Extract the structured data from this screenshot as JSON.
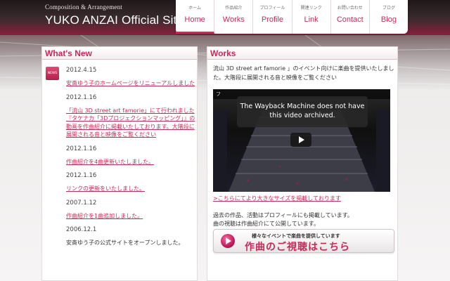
{
  "brand": {
    "subtitle": "Composition & Arrangement",
    "title": "YUKO ANZAI Official Site"
  },
  "nav": [
    {
      "jp": "ホーム",
      "en": "Home"
    },
    {
      "jp": "作品紹介",
      "en": "Works"
    },
    {
      "jp": "プロフィール",
      "en": "Profile"
    },
    {
      "jp": "関連リンク",
      "en": "Link"
    },
    {
      "jp": "お問い合わせ",
      "en": "Contact"
    },
    {
      "jp": "ブログ",
      "en": "Blog"
    }
  ],
  "whats_new": {
    "title": "What's New",
    "badge": "NEWS",
    "items": [
      {
        "date": "2012.4.15",
        "text": "安斎ゆう子のホームページをリニューアルしました"
      },
      {
        "date": "2012.1.16",
        "text": "「流山 3D street art famorie」にて行われました『タケナカ「3Dプロジェクションマッピング」』の動画を作曲紹介に掲載いたしております。大階段に展開される音と映像をご覧ください"
      },
      {
        "date": "2012.1.16",
        "text": "作曲紹介を4曲更新いたしました。"
      },
      {
        "date": "2012.1.16",
        "text": "リンクの更新をいたしました。"
      },
      {
        "date": "2007.1.12",
        "text": "作曲紹介を1曲追加しました。"
      },
      {
        "date": "2006.12.1",
        "text": "安斎ゆう子の公式サイトをオープンしました。"
      }
    ]
  },
  "works": {
    "title": "Works",
    "intro": "流山 3D street art famorie 」のイベント向けに楽曲を提供いたしました。大階段に展開される音と映像をご覧ください",
    "video_title": "フ",
    "wayback_msg": "The Wayback Machine does not have this video archived.",
    "large_link": ">こちらにてより大きなサイズを掲載しております",
    "past_line1": "過去の作品、活動はプロフィールにも掲載しています。",
    "past_line2": "曲の視聴は作曲紹介にて公開しています。",
    "banner_small": "様々なイベントで楽曲を提供しています",
    "banner_large": "作曲のご視聴はこちら"
  },
  "colors": {
    "accent": "#cc2a58",
    "header_dark": "#2a1f21"
  }
}
